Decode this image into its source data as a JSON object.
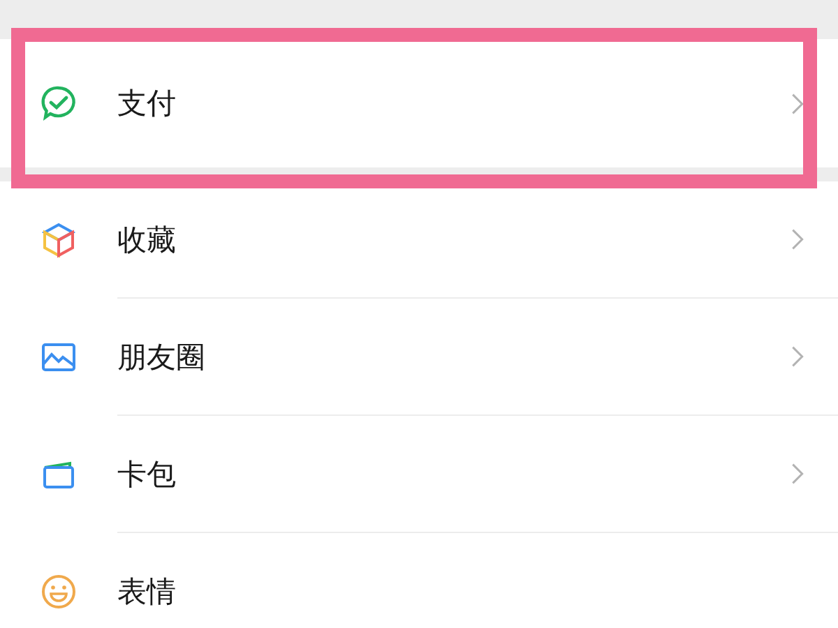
{
  "sections": [
    {
      "items": [
        {
          "label": "支付",
          "highlighted": true,
          "chevron": true
        }
      ]
    },
    {
      "items": [
        {
          "label": "收藏",
          "highlighted": false,
          "chevron": true
        },
        {
          "label": "朋友圈",
          "highlighted": false,
          "chevron": true
        },
        {
          "label": "卡包",
          "highlighted": false,
          "chevron": true
        },
        {
          "label": "表情",
          "highlighted": false,
          "chevron": false
        }
      ]
    }
  ]
}
